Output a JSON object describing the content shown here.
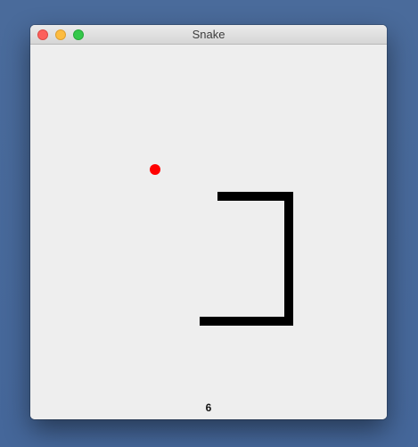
{
  "window": {
    "title": "Snake"
  },
  "game": {
    "score": "6",
    "snake_color": "#000000",
    "food_color": "#ff0000",
    "background_color": "#eeeeee"
  }
}
